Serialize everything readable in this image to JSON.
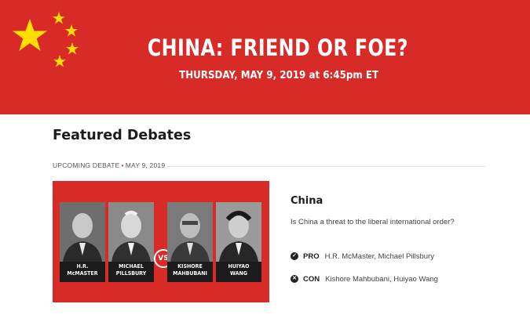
{
  "banner": {
    "title": "CHINA: FRIEND OR FOE?",
    "date": "THURSDAY, MAY 9, 2019 at 6:45pm ET",
    "color": "#d82a26",
    "star_color": "#ffde00"
  },
  "section_title": "Featured Debates",
  "meta": {
    "label": "UPCOMING DEBATE",
    "date": "MAY 9, 2019"
  },
  "card": {
    "speakers": [
      {
        "line1": "H.R.",
        "line2": "McMASTER"
      },
      {
        "line1": "MICHAEL",
        "line2": "PILLSBURY"
      },
      {
        "line1": "KISHORE",
        "line2": "MAHBUBANI"
      },
      {
        "line1": "HUIYAO",
        "line2": "WANG"
      }
    ],
    "vs": "VS",
    "title": "China",
    "description": "Is China a threat to the liberal international order?",
    "pro": {
      "icon": "check-icon",
      "label": "PRO",
      "names": "H.R. McMaster, Michael Pillsbury"
    },
    "con": {
      "icon": "cross-icon",
      "label": "CON",
      "names": "Kishore Mahbubani, Huiyao Wang"
    }
  }
}
